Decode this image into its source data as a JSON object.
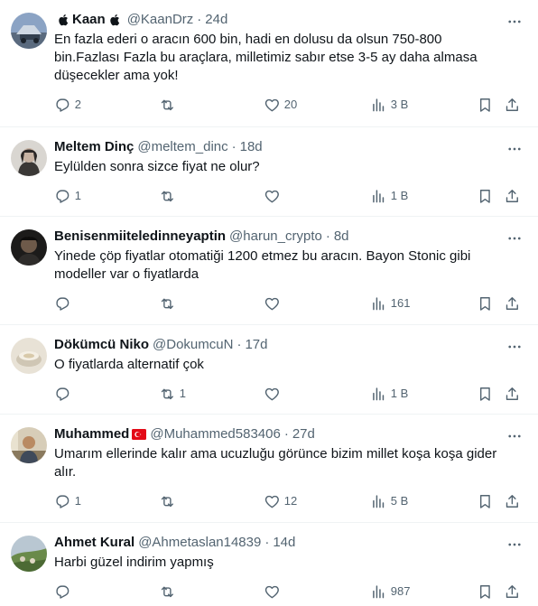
{
  "tweets": [
    {
      "name": "Kaan",
      "name_prefix_icon": "apple-icon",
      "name_suffix_icon": "apple-icon",
      "handle": "@KaanDrz",
      "time": "24d",
      "text": "En fazla ederi o aracın 600 bin, hadi en dolusu da olsun 750-800 bin.Fazlası Fazla bu araçlara, milletimiz sabır etse 3-5 ay daha almasa düşecekler ama yok!",
      "replies": "2",
      "retweets": "",
      "likes": "20",
      "views": "3 B"
    },
    {
      "name": "Meltem Dinç",
      "handle": "@meltem_dinc",
      "time": "18d",
      "text": "Eylülden sonra sizce fiyat ne olur?",
      "replies": "1",
      "retweets": "",
      "likes": "",
      "views": "1 B"
    },
    {
      "name": "Benisenmiiteledinneyaptin",
      "handle": "@harun_crypto",
      "time": "8d",
      "text": "Yinede çöp fiyatlar otomatiği 1200 etmez bu aracın. Bayon Stonic gibi modeller var o fiyatlarda",
      "replies": "",
      "retweets": "",
      "likes": "",
      "views": "161"
    },
    {
      "name": "Dökümcü Niko",
      "handle": "@DokumcuN",
      "time": "17d",
      "text": "O fiyatlarda alternatif çok",
      "replies": "",
      "retweets": "1",
      "likes": "",
      "views": "1 B"
    },
    {
      "name": "Muhammed",
      "name_suffix_icon": "turkey-flag-icon",
      "handle": "@Muhammed583406",
      "time": "27d",
      "text": "Umarım ellerinde kalır ama ucuzluğu görünce bizim millet koşa koşa gider alır.",
      "replies": "1",
      "retweets": "",
      "likes": "12",
      "views": "5 B"
    },
    {
      "name": "Ahmet Kural",
      "handle": "@Ahmetaslan14839",
      "time": "14d",
      "text": "Harbi güzel indirim yapmış",
      "replies": "",
      "retweets": "",
      "likes": "",
      "views": "987"
    }
  ],
  "colors": {
    "text": "#0f1419",
    "secondary": "#536471",
    "divider": "#eff3f4",
    "flag_red": "#e30a17"
  }
}
